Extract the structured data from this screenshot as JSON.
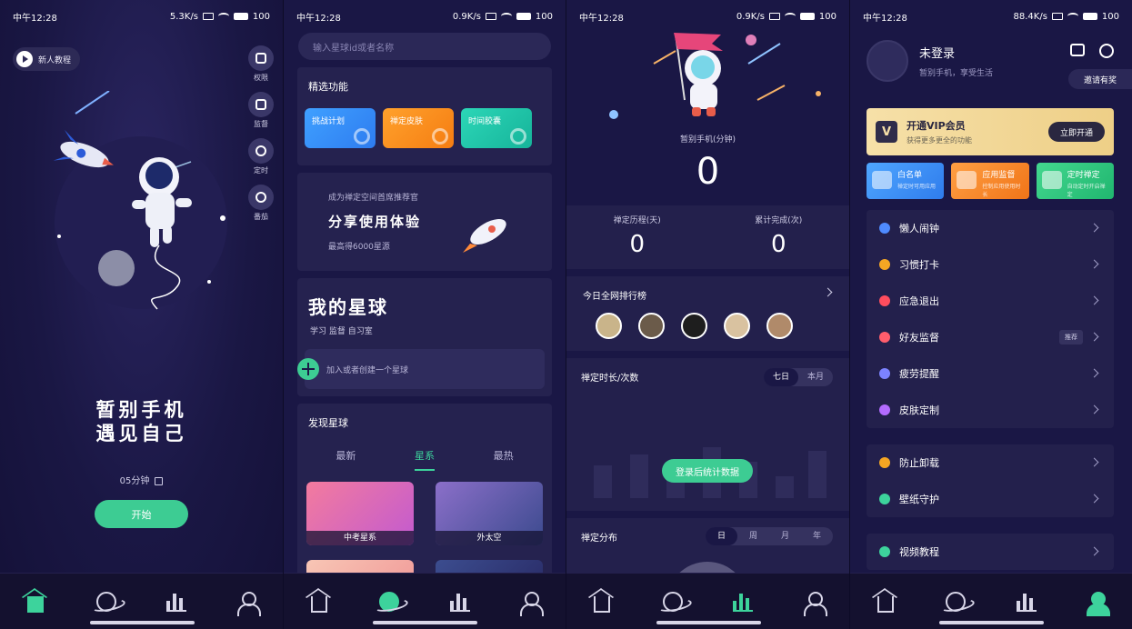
{
  "status_bars": [
    {
      "time": "中午12:28",
      "speed": "5.3K/s",
      "battery": "100"
    },
    {
      "time": "中午12:28",
      "speed": "0.9K/s",
      "battery": "100"
    },
    {
      "time": "中午12:28",
      "speed": "0.9K/s",
      "battery": "100"
    },
    {
      "time": "中午12:28",
      "speed": "88.4K/s",
      "battery": "100"
    }
  ],
  "screen1": {
    "tutorial_label": "新人教程",
    "side_tools": [
      "权限",
      "监督",
      "定时",
      "番茄"
    ],
    "slogan_line1": "暂别手机",
    "slogan_line2": "遇见自己",
    "duration": "05分钟",
    "start_button": "开始"
  },
  "screen2": {
    "search_placeholder": "输入星球id或者名称",
    "featured_title": "精选功能",
    "featured": [
      "挑战计划",
      "禅定皮肤",
      "时间胶囊"
    ],
    "share_small": "成为禅定空间首席推荐官",
    "share_big": "分享使用体验",
    "share_reward": "最高得6000星源",
    "my_planet_title": "我的星球",
    "my_planet_tags": "学习 监督 自习室",
    "join_text": "加入或者创建一个星球",
    "discover_title": "发现星球",
    "discover_tabs": [
      "最新",
      "星系",
      "最热"
    ],
    "gallery": [
      "中考星系",
      "外太空"
    ]
  },
  "screen3": {
    "phone_label": "暂别手机(分钟)",
    "phone_value": "0",
    "stats": [
      {
        "label": "禅定历程(天)",
        "value": "0"
      },
      {
        "label": "累计完成(次)",
        "value": "0"
      }
    ],
    "rank_title": "今日全网排行榜",
    "chart_title": "禅定时长/次数",
    "chart_tabs": [
      "七日",
      "本月"
    ],
    "login_button": "登录后统计数据",
    "dist_title": "禅定分布",
    "dist_tabs": [
      "日",
      "周",
      "月",
      "年"
    ]
  },
  "screen4": {
    "name": "未登录",
    "subtitle": "暂别手机，享受生活",
    "invite": "邀请有奖",
    "vip_icon": "V",
    "vip_title": "开通VIP会员",
    "vip_sub": "获得更多更全的功能",
    "vip_button": "立即开通",
    "tiles": [
      {
        "title": "白名单",
        "sub": "禅定时可用应用"
      },
      {
        "title": "应用监督",
        "sub": "控制应用使用时长"
      },
      {
        "title": "定时禅定",
        "sub": "自动定时开启禅定"
      }
    ],
    "menu1": [
      "懒人闹钟",
      "习惯打卡",
      "应急退出",
      "好友监督",
      "疲劳提醒",
      "皮肤定制"
    ],
    "menu1_tag": "推荐",
    "menu2": [
      "防止卸载",
      "壁纸守护"
    ],
    "menu3": [
      "视频教程"
    ]
  },
  "colors": {
    "accent": "#3dd39c",
    "background": "#1a1745",
    "card": "#23204c",
    "vip_gold": "#f6e0a8"
  }
}
